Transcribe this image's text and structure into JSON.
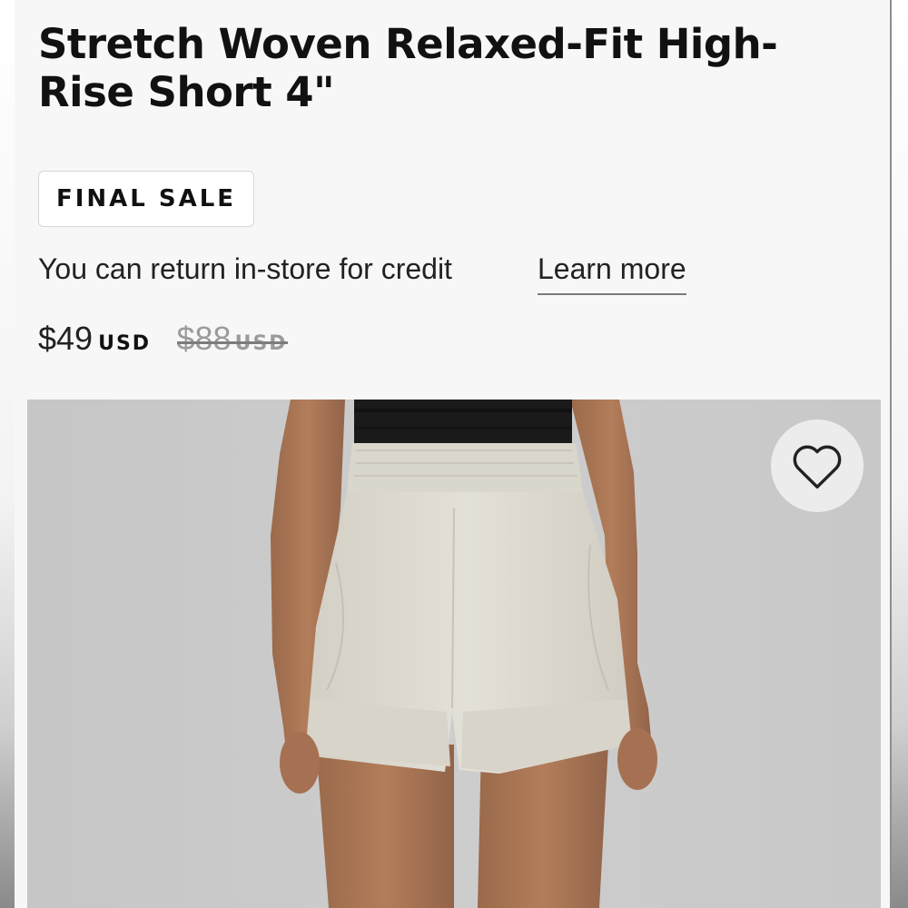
{
  "product": {
    "title": "Stretch Woven Relaxed-Fit High-Rise Short 4\"",
    "badge": "FINAL SALE",
    "returns_text": "You can return in-store for credit",
    "learn_more": "Learn more",
    "price": {
      "current": "$49",
      "currency": "USD",
      "original": "$88",
      "original_currency": "USD"
    }
  },
  "image": {
    "wishlist_icon": "heart-outline-icon"
  },
  "colors": {
    "background": "#f7f7f7",
    "text": "#1c1c1c",
    "strike": "#9b9b9b",
    "image_bg": "#cbcbcb",
    "shorts": "#dedbd1"
  }
}
